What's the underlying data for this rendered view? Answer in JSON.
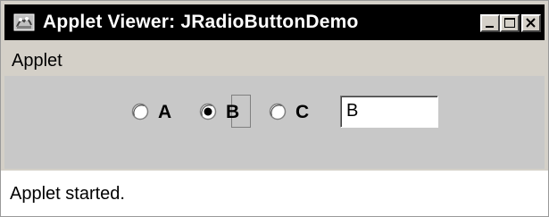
{
  "window": {
    "title": "Applet Viewer: JRadioButtonDemo",
    "app_icon": "java-applet-icon",
    "controls": {
      "minimize_icon": "minimize-icon",
      "maximize_icon": "maximize-icon",
      "close_icon": "close-icon"
    }
  },
  "menubar": {
    "items": [
      {
        "label": "Applet"
      }
    ]
  },
  "panel": {
    "radios": [
      {
        "label": "A",
        "selected": false
      },
      {
        "label": "B",
        "selected": true
      },
      {
        "label": "C",
        "selected": false
      }
    ],
    "textfield": {
      "value": "B"
    }
  },
  "status": {
    "text": "Applet started."
  },
  "colors": {
    "titlebar": "#000000",
    "window_face": "#d4d0c8",
    "panel": "#c8c8c8",
    "status_bg": "#ffffff"
  }
}
